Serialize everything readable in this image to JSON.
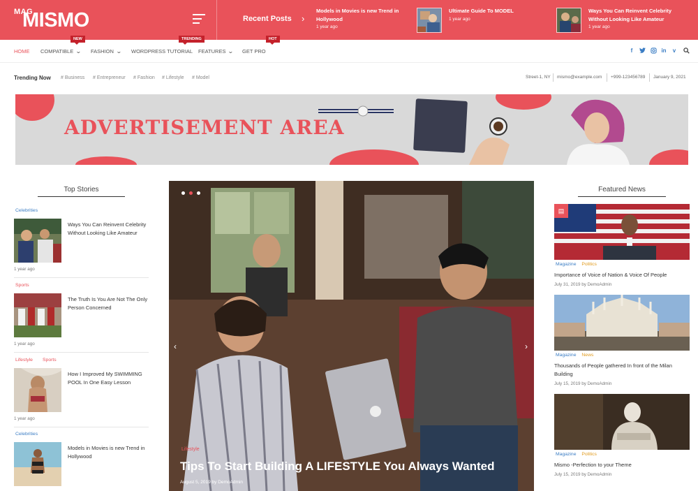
{
  "header": {
    "logo_small": "MAG",
    "logo_name": "MISMO",
    "recent_label": "Recent Posts",
    "recent_posts": [
      {
        "title": "Models in Movies is new Trend in Hollywood",
        "time": "1 year ago"
      },
      {
        "title": "Ultimate Guide To MODEL",
        "time": "1 year ago"
      },
      {
        "title": "Ways You Can Reinvent Celebrity Without Looking Like Amateur",
        "time": "1 year ago"
      }
    ]
  },
  "nav": {
    "items": [
      {
        "label": "HOME",
        "badge": ""
      },
      {
        "label": "COMPATIBLE",
        "badge": "NEW"
      },
      {
        "label": "FASHION",
        "badge": ""
      },
      {
        "label": "WORDPRESS TUTORIAL",
        "badge": "TRENDING"
      },
      {
        "label": "FEATURES",
        "badge": ""
      },
      {
        "label": "GET PRO",
        "badge": "HOT"
      }
    ],
    "social": [
      "facebook-icon",
      "twitter-icon",
      "instagram-icon",
      "linkedin-icon",
      "vimeo-icon",
      "search-icon"
    ]
  },
  "trending": {
    "label": "Trending Now",
    "tags": [
      "# Business",
      "# Entrepreneur",
      "# Fashion",
      "# Lifestyle",
      "# Model"
    ],
    "info": [
      "Street-1, NY",
      "mismo@example.com",
      "+999-123456789",
      "January 9, 2021"
    ]
  },
  "ad": {
    "text": "ADVERTISEMENT AREA"
  },
  "top_stories": {
    "title": "Top Stories",
    "items": [
      {
        "cats": [
          "Celebrities"
        ],
        "title": "Ways You Can Reinvent Celebrity Without Looking Like Amateur",
        "time": "1 year ago"
      },
      {
        "cats": [
          "Sports"
        ],
        "title": "The Truth Is You Are Not The Only Person Concerned",
        "time": "1 year ago"
      },
      {
        "cats": [
          "Lifestyle",
          "Sports"
        ],
        "title": "How I Improved My SWIMMING POOL In One Easy Lesson",
        "time": "1 year ago"
      },
      {
        "cats": [
          "Celebrities"
        ],
        "title": "Models in Movies is new Trend in Hollywood",
        "time": ""
      }
    ]
  },
  "slider": {
    "category": "Lifestyle",
    "title": "Tips To Start Building A LIFESTYLE You Always Wanted",
    "meta": "August 5, 2019 by DemoAdmin",
    "prev_label": "‹",
    "next_label": "›"
  },
  "featured": {
    "title": "Featured News",
    "items": [
      {
        "cats": [
          "Magazine",
          "Politics"
        ],
        "title": "Importance of Voice of Nation & Voice Of People",
        "meta": "July 31, 2019 by DemoAdmin"
      },
      {
        "cats": [
          "Magazine",
          "News"
        ],
        "title": "Thousands of People gathered In front of the Milan Building",
        "meta": "July 15, 2019 by DemoAdmin"
      },
      {
        "cats": [
          "Magazine",
          "Politics"
        ],
        "title": "Mismo -Perfection to your Theme",
        "meta": "July 15, 2019 by DemoAdmin"
      }
    ]
  },
  "colors": {
    "accent": "#e9525a",
    "badge": "#c4212b",
    "link": "#3b7dc4",
    "category_orange": "#e09a1c"
  }
}
